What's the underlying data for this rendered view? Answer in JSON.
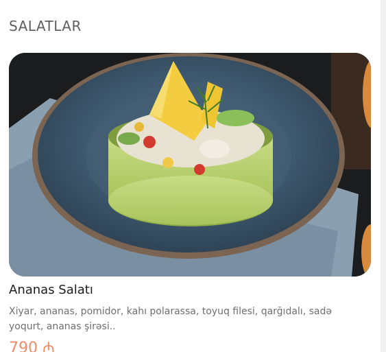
{
  "section": {
    "title": "SALATLAR"
  },
  "item": {
    "name": "Ananas Salatı",
    "description": "Xiyar, ananas, pomidor, kahı polarassa, toyuq filesi, qarğıdalı, sadə yoqurt, ananas şirəsi..",
    "price": "790 ₼",
    "image_icon": "salad-photo"
  },
  "colors": {
    "title": "#5e5e5e",
    "name": "#1c1c1c",
    "description": "#6f6f6f",
    "price": "#f28b68"
  }
}
